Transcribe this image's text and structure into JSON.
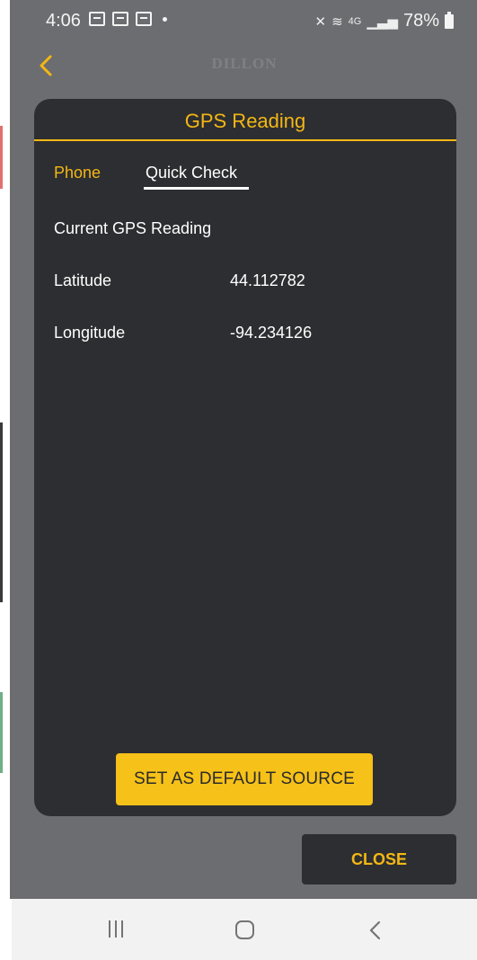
{
  "status_bar": {
    "time": "4:06",
    "battery": "78%",
    "network": "4G"
  },
  "header": {
    "brand": "DILLON"
  },
  "dialog": {
    "title": "GPS Reading",
    "tabs": [
      {
        "label": "Phone"
      },
      {
        "label": "Quick Check"
      }
    ],
    "section_label": "Current GPS Reading",
    "rows": [
      {
        "label": "Latitude",
        "value": "44.112782"
      },
      {
        "label": "Longitude",
        "value": "-94.234126"
      }
    ],
    "default_button": "SET AS DEFAULT SOURCE"
  },
  "close_button": "CLOSE",
  "colors": {
    "accent": "#f3b715",
    "dialog_bg": "#2d2e31",
    "screen_bg": "#6c6d70"
  }
}
